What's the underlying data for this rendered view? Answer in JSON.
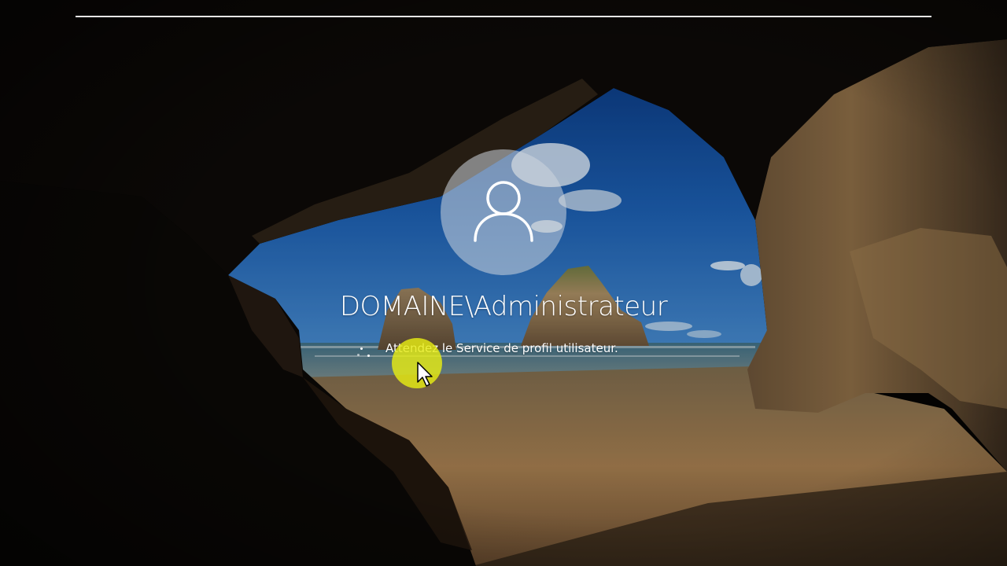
{
  "login": {
    "account_name": "DOMAINE\\Administrateur",
    "status_message": "Attendez le Service de profil utilisateur."
  },
  "icons": {
    "avatar": "user-avatar-icon",
    "spinner": "loading-dots-icon",
    "cursor": "mouse-pointer-icon"
  },
  "colors": {
    "text": "#ffffff",
    "avatar_circle": "#cdd6de",
    "cursor_highlight": "#e6eb14",
    "top_rule": "#e6e6e6"
  }
}
